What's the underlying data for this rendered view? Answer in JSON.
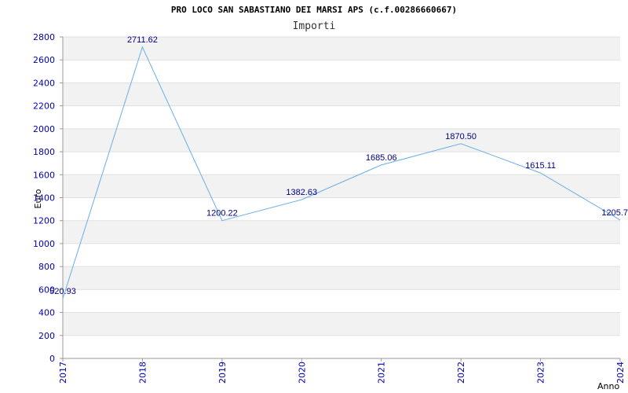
{
  "chart_data": {
    "type": "line",
    "title": "PRO LOCO SAN SABASTIANO DEI MARSI APS (c.f.00286660667)",
    "subtitle": "Importi",
    "xlabel": "Anno",
    "ylabel": "Euro",
    "x": [
      "2017",
      "2018",
      "2019",
      "2020",
      "2021",
      "2022",
      "2023",
      "2024"
    ],
    "values": [
      520.93,
      2711.62,
      1200.22,
      1382.63,
      1685.06,
      1870.5,
      1615.11,
      1205.7
    ],
    "data_labels": [
      "520.93",
      "2711.62",
      "1200.22",
      "1382.63",
      "1685.06",
      "1870.50",
      "1615.11",
      "1205.7"
    ],
    "ylim": [
      0,
      2800
    ],
    "yticks": [
      0,
      200,
      400,
      600,
      800,
      1000,
      1200,
      1400,
      1600,
      1800,
      2000,
      2200,
      2400,
      2600,
      2800
    ],
    "grid": true,
    "band_colors": [
      "#ffffff",
      "#f2f2f2"
    ],
    "line_color": "#6aaee8",
    "tick_color": "#0000aa",
    "label_color": "#000080"
  }
}
